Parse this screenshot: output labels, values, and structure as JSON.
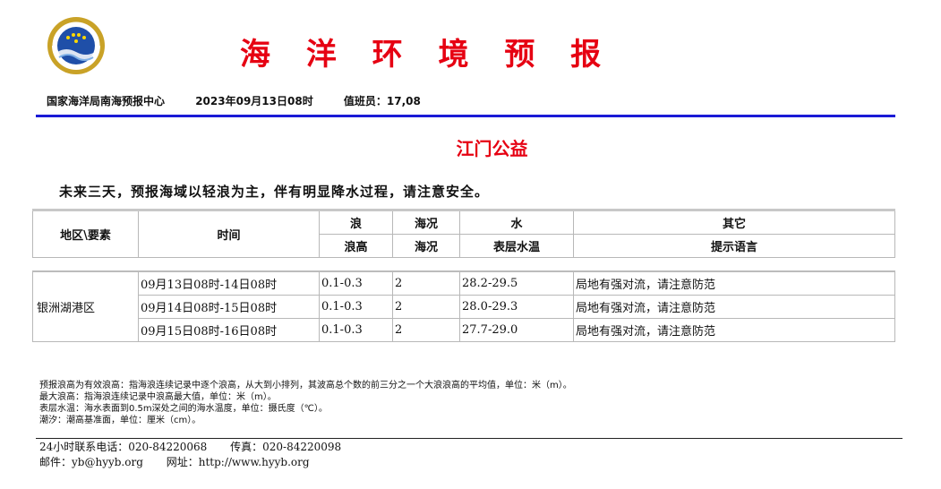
{
  "header": {
    "logo": {
      "icon": "national-ocean-logo-icon",
      "ring_text": "国家海洋局",
      "colors": {
        "blue": "#1f4fa8",
        "gold": "#c9a227"
      }
    },
    "title": "海 洋 环 境 预 报",
    "issuer": "国家海洋局南海预报中心",
    "datetime": "2023年09月13日08时",
    "on_duty": "值班员：17,08"
  },
  "station": "江门公益",
  "summary": "未来三天，预报海域以轻浪为主，伴有明显降水过程，请注意安全。",
  "table": {
    "head": {
      "region": "地区\\要素",
      "time": "时间",
      "wave_group": "浪",
      "sea_group": "海况",
      "water_group": "水",
      "other_group": "其它",
      "wave_height": "浪高",
      "sea_state": "海况",
      "sst": "表层水温",
      "hint": "提示语言"
    },
    "region_name": "银洲湖港区",
    "rows": [
      {
        "time": "09月13日08时-14日08时",
        "wave": "0.1-0.3",
        "sea": "2",
        "sst": "28.2-29.5",
        "hint": "局地有强对流，请注意防范"
      },
      {
        "time": "09月14日08时-15日08时",
        "wave": "0.1-0.3",
        "sea": "2",
        "sst": "28.0-29.3",
        "hint": "局地有强对流，请注意防范"
      },
      {
        "time": "09月15日08时-16日08时",
        "wave": "0.1-0.3",
        "sea": "2",
        "sst": "27.7-29.0",
        "hint": "局地有强对流，请注意防范"
      }
    ]
  },
  "notes": [
    "预报浪高为有效浪高：指海浪连续记录中逐个浪高，从大到小排列，其波高总个数的前三分之一个大浪浪高的平均值，单位：米（m）。",
    "最大浪高：指海浪连续记录中浪高最大值，单位：米（m）。",
    "表层水温：海水表面到0.5m深处之间的海水温度，单位：摄氏度（℃）。",
    "潮汐：潮高基准面，单位：厘米（cm）。"
  ],
  "contact": {
    "phone": "24小时联系电话：020-84220068",
    "fax": "传真：020-84220098",
    "email": "邮件：yb@hyyb.org",
    "website": "网址：http://www.hyyb.org"
  },
  "colors": {
    "title_red": "#e60012",
    "rule_blue": "#1a1ad6"
  }
}
